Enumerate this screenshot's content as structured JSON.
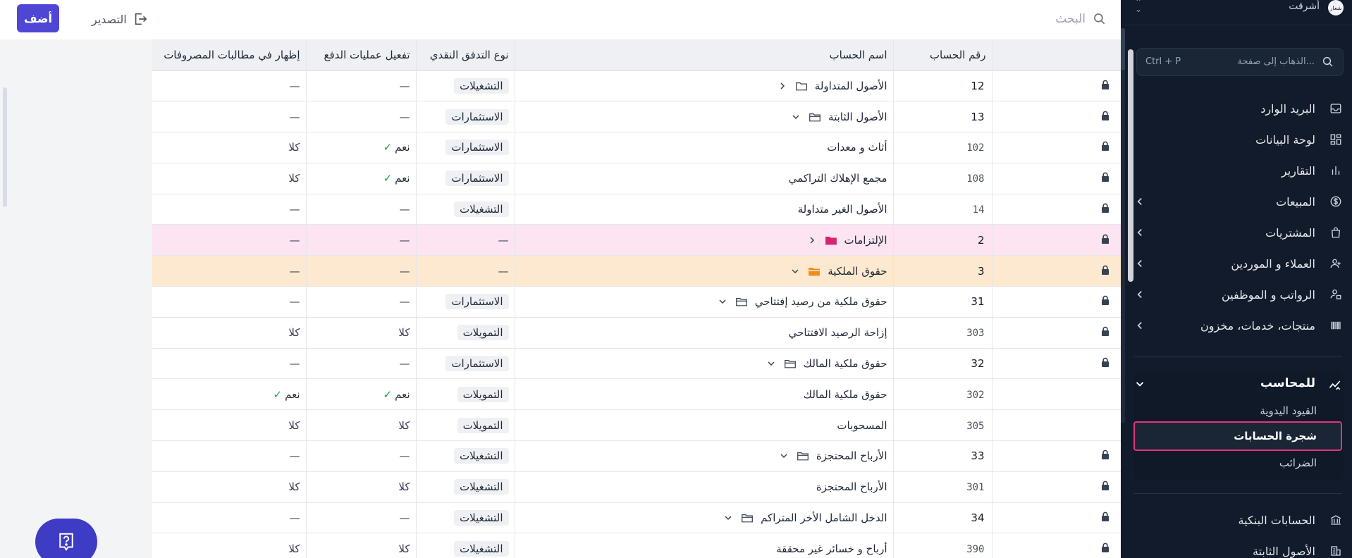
{
  "topbar": {
    "search_label": "البحث",
    "export_label": "التصدير",
    "add_label": "أضف"
  },
  "sidebar": {
    "org_name": "أشرقت",
    "org_avatar": "شعار",
    "search_placeholder": "الذهاب إلى صفحة...",
    "search_shortcut": "Ctrl + P",
    "items": [
      {
        "label": "البريد الوارد",
        "icon": "inbox-icon",
        "chevron": false
      },
      {
        "label": "لوحة البيانات",
        "icon": "dashboard-icon",
        "chevron": false
      },
      {
        "label": "التقارير",
        "icon": "reports-icon",
        "chevron": false
      },
      {
        "label": "المبيعات",
        "icon": "dollar-icon",
        "chevron": true
      },
      {
        "label": "المشتريات",
        "icon": "shopping-bag-icon",
        "chevron": true
      },
      {
        "label": "العملاء و الموردين",
        "icon": "users-icon",
        "chevron": true
      },
      {
        "label": "الرواتب و الموظفين",
        "icon": "payroll-icon",
        "chevron": true
      },
      {
        "label": "منتجات، خدمات، مخزون",
        "icon": "barcode-icon",
        "chevron": true
      }
    ],
    "group": {
      "label": "للمحاسب",
      "icon": "accountant-icon",
      "sub_items": [
        "القيود اليدوية",
        "شجرة الحسابات",
        "الضرائب"
      ],
      "active": "شجرة الحسابات"
    },
    "bottom_items": [
      {
        "label": "الحسابات البنكية",
        "icon": "bank-icon"
      },
      {
        "label": "الأصول الثابتة",
        "icon": "building-icon"
      }
    ]
  },
  "table": {
    "columns": {
      "show_in_claims": "إظهار في مطالبات المصروفات",
      "enable_payments": "تفعيل عمليات الدفع",
      "cash_flow_type": "نوع التدفق النقدي",
      "account_name": "اسم الحساب",
      "account_number": "رقم الحساب"
    },
    "rows": [
      {
        "num": "12",
        "name": "الأصول المتداولة",
        "kind": "folder",
        "expanded": false,
        "flow": "التشغيلات",
        "pay": "—",
        "show": "—",
        "locked": true,
        "hl": ""
      },
      {
        "num": "13",
        "name": "الأصول الثابتة",
        "kind": "folder",
        "expanded": true,
        "flow": "الاستثمارات",
        "pay": "—",
        "show": "—",
        "locked": true,
        "hl": ""
      },
      {
        "num": "102",
        "name": "أثاث و معدات",
        "kind": "leaf",
        "expanded": false,
        "flow": "الاستثمارات",
        "pay": "نعم",
        "show": "كلا",
        "locked": true,
        "hl": ""
      },
      {
        "num": "108",
        "name": "مجمع الإهلاك التراكمي",
        "kind": "leaf",
        "expanded": false,
        "flow": "الاستثمارات",
        "pay": "نعم",
        "show": "كلا",
        "locked": true,
        "hl": ""
      },
      {
        "num": "14",
        "name": "الأصول الغير متداولة",
        "kind": "leaf",
        "expanded": false,
        "flow": "التشغيلات",
        "pay": "—",
        "show": "—",
        "locked": true,
        "hl": ""
      },
      {
        "num": "2",
        "name": "الإلتزامات",
        "kind": "folder-pink",
        "expanded": false,
        "flow": "—",
        "pay": "—",
        "show": "—",
        "locked": true,
        "hl": "pink"
      },
      {
        "num": "3",
        "name": "حقوق الملكية",
        "kind": "folder-orange",
        "expanded": true,
        "flow": "—",
        "pay": "—",
        "show": "—",
        "locked": true,
        "hl": "orange"
      },
      {
        "num": "31",
        "name": "حقوق ملكية من رصيد إفتتاحي",
        "kind": "folder",
        "expanded": true,
        "flow": "الاستثمارات",
        "pay": "—",
        "show": "—",
        "locked": true,
        "hl": ""
      },
      {
        "num": "303",
        "name": "إزاحة الرصيد الافتتاحي",
        "kind": "leaf",
        "expanded": false,
        "flow": "التمويلات",
        "pay": "كلا",
        "show": "كلا",
        "locked": true,
        "hl": ""
      },
      {
        "num": "32",
        "name": "حقوق ملكية المالك",
        "kind": "folder",
        "expanded": true,
        "flow": "الاستثمارات",
        "pay": "—",
        "show": "—",
        "locked": true,
        "hl": ""
      },
      {
        "num": "302",
        "name": "حقوق ملكية المالك",
        "kind": "leaf",
        "expanded": false,
        "flow": "التمويلات",
        "pay": "نعم",
        "show": "نعم",
        "locked": false,
        "hl": ""
      },
      {
        "num": "305",
        "name": "المسحوبات",
        "kind": "leaf",
        "expanded": false,
        "flow": "التمويلات",
        "pay": "كلا",
        "show": "كلا",
        "locked": false,
        "hl": ""
      },
      {
        "num": "33",
        "name": "الأرباح المحتجزة",
        "kind": "folder",
        "expanded": true,
        "flow": "التشغيلات",
        "pay": "—",
        "show": "—",
        "locked": true,
        "hl": ""
      },
      {
        "num": "301",
        "name": "الأرباح المحتجزة",
        "kind": "leaf",
        "expanded": false,
        "flow": "التشغيلات",
        "pay": "كلا",
        "show": "كلا",
        "locked": true,
        "hl": ""
      },
      {
        "num": "34",
        "name": "الدخل الشامل الأخر المتراكم",
        "kind": "folder",
        "expanded": true,
        "flow": "التشغيلات",
        "pay": "—",
        "show": "—",
        "locked": true,
        "hl": ""
      },
      {
        "num": "390",
        "name": "أرباح و خسائر غير محققة",
        "kind": "leaf",
        "expanded": false,
        "flow": "التشغيلات",
        "pay": "كلا",
        "show": "كلا",
        "locked": true,
        "hl": ""
      }
    ]
  },
  "colors": {
    "primary": "#4f46d6",
    "sidebar_bg": "#111b2b",
    "highlight_pink": "#fce4f2",
    "highlight_orange": "#fde9cf",
    "active_border": "#e2357c",
    "check_green": "#16a34a",
    "folder_pink": "#d6246e",
    "folder_orange": "#f08c1a"
  }
}
